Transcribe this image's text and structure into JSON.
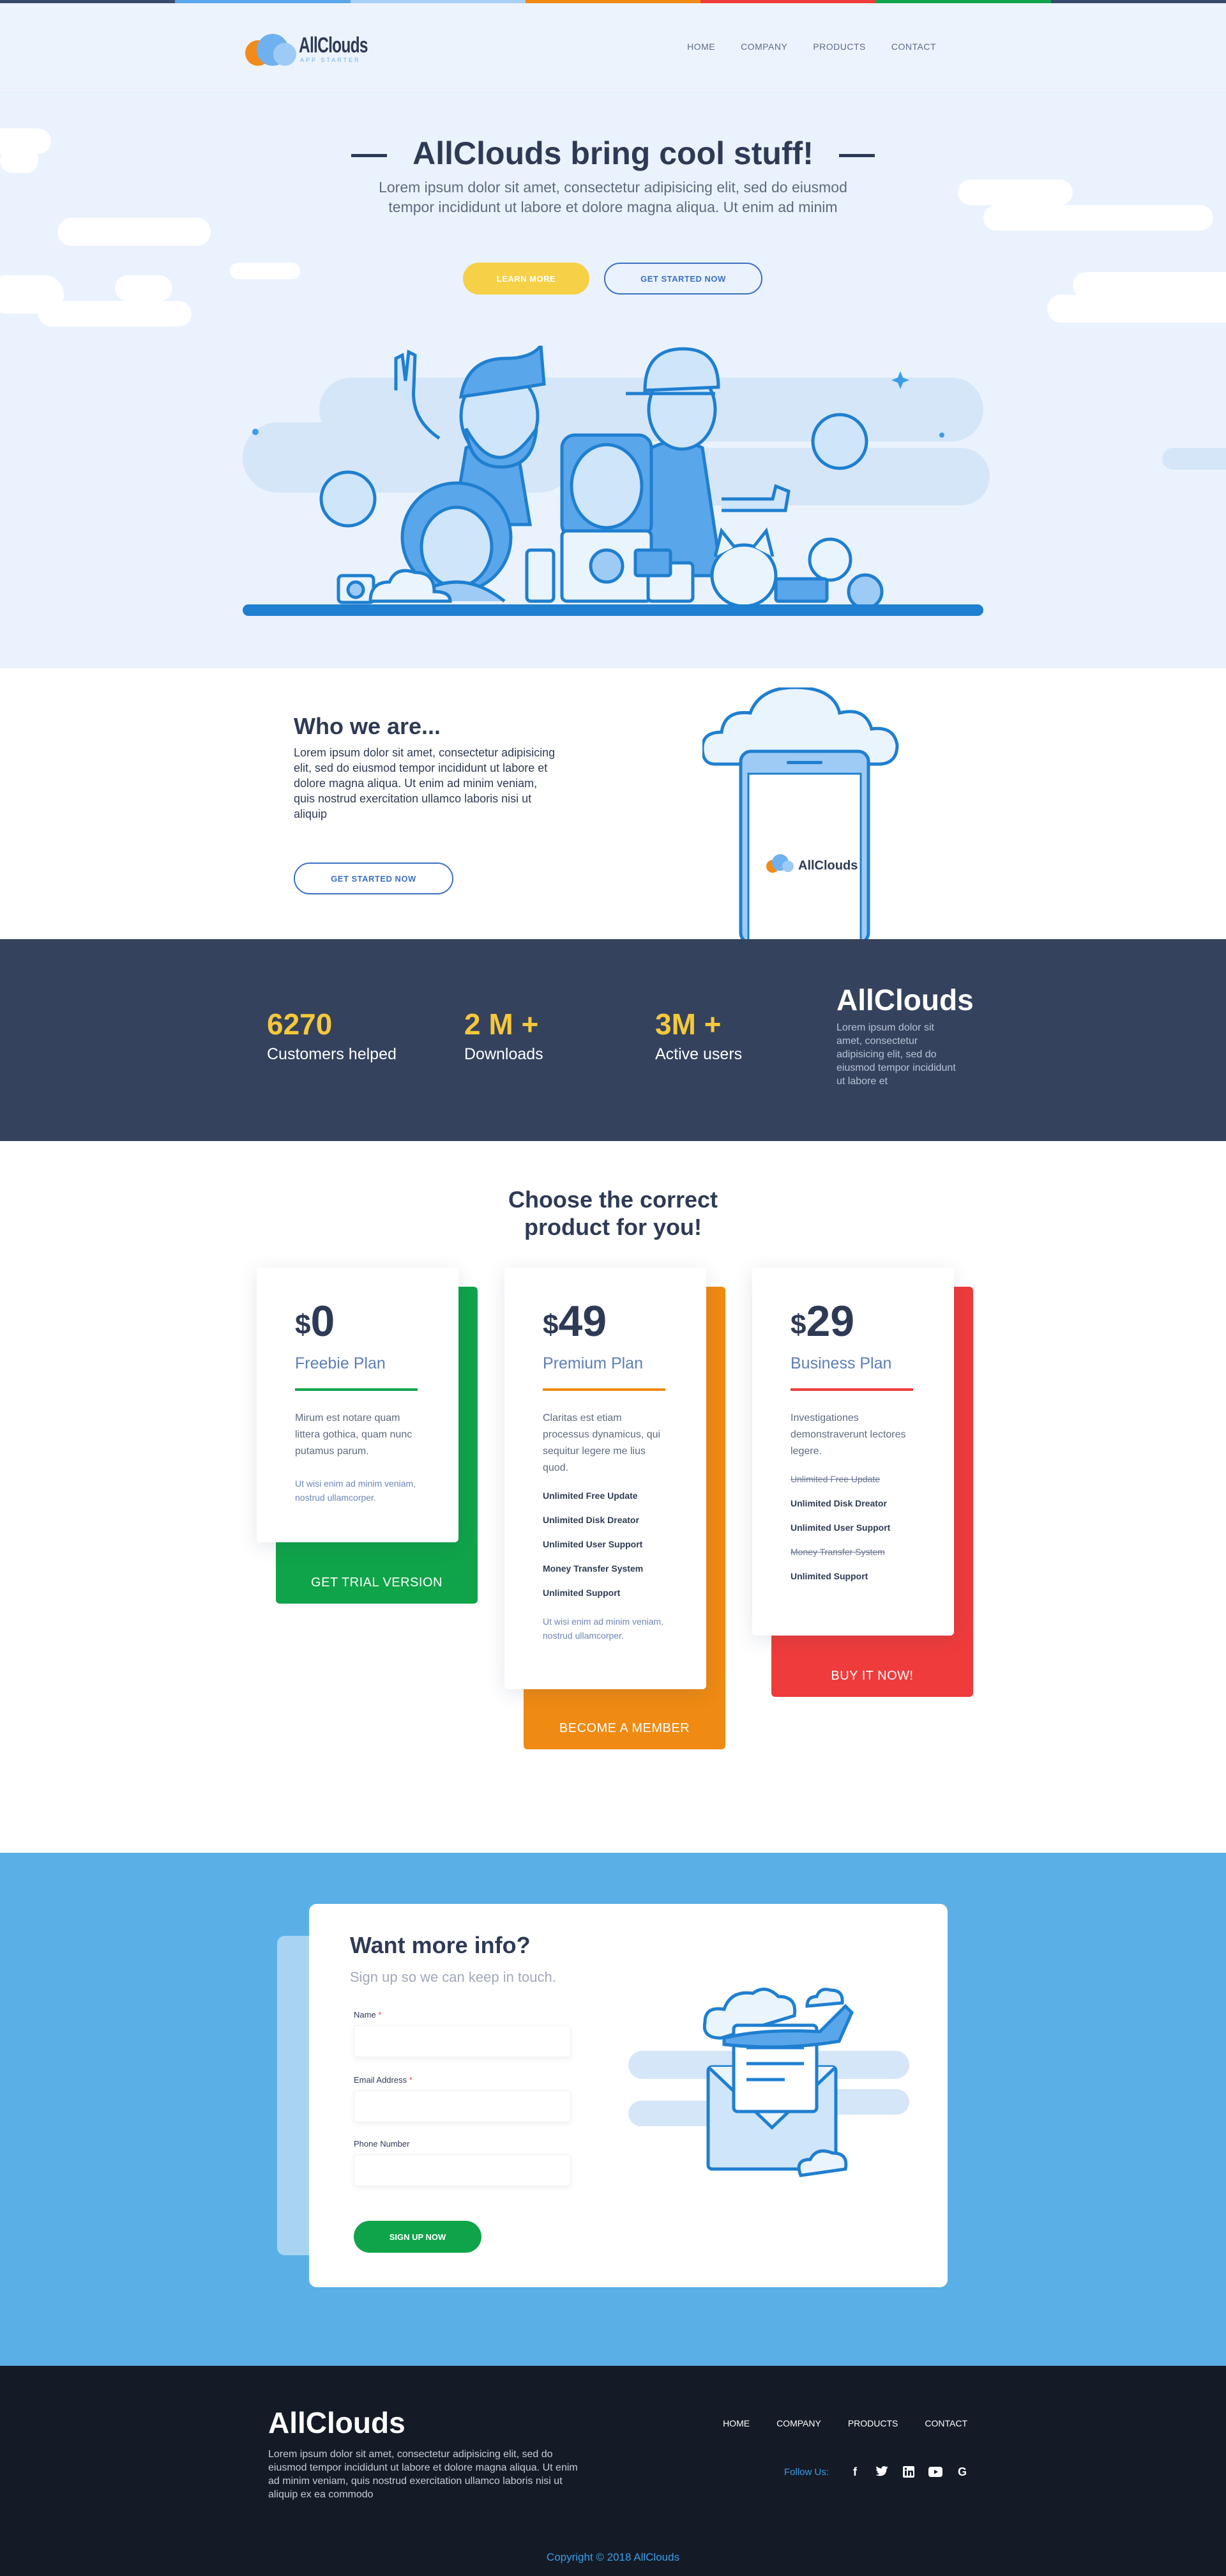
{
  "colors": {
    "yellow": "#f6d047",
    "blue": "#3a6fc4",
    "navy": "#34425d",
    "green": "#0fa449",
    "orange": "#ef8a12",
    "red": "#ef3b3b",
    "sky": "#5aafe6"
  },
  "header": {
    "logo_name": "AllClouds",
    "logo_sub": "APP STARTER",
    "nav": [
      "HOME",
      "COMPANY",
      "PRODUCTS",
      "CONTACT"
    ]
  },
  "hero": {
    "title": "AllClouds bring cool stuff!",
    "subtitle": "Lorem ipsum dolor sit amet, consectetur adipisicing elit, sed do eiusmod tempor incididunt ut labore et dolore magna aliqua. Ut enim ad minim",
    "btn_learn": "LEARN MORE",
    "btn_start": "GET STARTED NOW"
  },
  "who": {
    "title": "Who we are...",
    "text": "Lorem ipsum dolor sit amet, consectetur adipisicing elit, sed do eiusmod tempor incididunt ut labore et dolore magna aliqua. Ut enim ad minim veniam, quis nostrud exercitation ullamco laboris nisi ut aliquip",
    "btn": "GET STARTED NOW",
    "phone_logo": "AllClouds"
  },
  "stats": {
    "items": [
      {
        "num": "6270",
        "label": "Customers helped"
      },
      {
        "num": "2 M +",
        "label": "Downloads"
      },
      {
        "num": "3M +",
        "label": "Active users"
      }
    ],
    "brand": "AllClouds",
    "desc": "Lorem ipsum dolor sit amet, consectetur adipisicing elit, sed do eiusmod tempor incididunt ut labore et"
  },
  "pricing": {
    "title_line1": "Choose the correct",
    "title_line2": "product for you!",
    "plans": [
      {
        "currency": "$",
        "price": "0",
        "name": "Freebie Plan",
        "desc": "Mirum est notare quam littera gothica, quam nunc putamus parum.",
        "extra": "Ut wisi enim ad minim veniam, nostrud ullamcorper.",
        "button": "GET TRIAL VERSION"
      },
      {
        "currency": "$",
        "price": "49",
        "name": "Premium Plan",
        "desc": "Claritas est etiam processus dynamicus, qui sequitur legere me lius quod.",
        "features": [
          "Unlimited Free Update",
          "Unlimited Disk Dreator",
          "Unlimited User Support",
          "Money Transfer System",
          "Unlimited Support"
        ],
        "extra": "Ut wisi enim ad minim veniam, nostrud ullamcorper.",
        "button": "BECOME A MEMBER"
      },
      {
        "currency": "$",
        "price": "29",
        "name": "Business Plan",
        "desc": "Investigationes demonstraverunt lectores legere.",
        "features": [
          "Unlimited Free Update",
          "Unlimited Disk Dreator",
          "Unlimited User Support",
          "Money Transfer System",
          "Unlimited Support"
        ],
        "button": "BUY IT NOW!"
      }
    ]
  },
  "contact": {
    "title": "Want more info?",
    "subtitle": "Sign up so we can keep in touch.",
    "name_label": "Name",
    "email_label": "Email Address",
    "phone_label": "Phone Number",
    "required_mark": "*",
    "btn": "SIGN UP NOW"
  },
  "footer": {
    "brand": "AllClouds",
    "desc": "Lorem ipsum dolor sit amet, consectetur adipisicing elit, sed do eiusmod tempor incididunt ut labore et dolore magna aliqua. Ut enim ad minim veniam, quis nostrud exercitation ullamco laboris nisi ut aliquip ex ea commodo",
    "nav": [
      "HOME",
      "COMPANY",
      "PRODUCTS",
      "CONTACT"
    ],
    "follow": "Follow Us:",
    "socials": [
      "facebook-icon",
      "twitter-icon",
      "linkedin-icon",
      "youtube-icon",
      "google-icon"
    ],
    "copyright": "Copyright © 2018 AllClouds"
  }
}
